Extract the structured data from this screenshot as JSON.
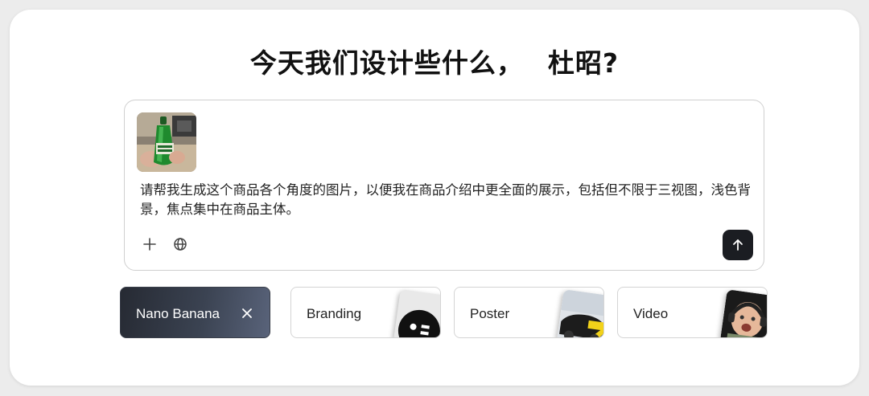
{
  "heading": {
    "text": "今天我们设计些什么，",
    "name": "杜昭?"
  },
  "prompt": {
    "attachment_icon": "product-photo-icon",
    "text": "请帮我生成这个商品各个角度的图片，以便我在商品介绍中更全面的展示，包括但不限于三视图，浅色背景，焦点集中在商品主体。",
    "tools": [
      {
        "icon": "plus-icon"
      },
      {
        "icon": "globe-icon"
      }
    ],
    "send_icon": "arrow-up-icon"
  },
  "chips": [
    {
      "label": "Nano Banana",
      "selected": true,
      "icon": "close-icon"
    },
    {
      "label": "Branding",
      "selected": false,
      "icon": "branding-thumbnail-icon"
    },
    {
      "label": "Poster",
      "selected": false,
      "icon": "car-poster-thumbnail-icon"
    },
    {
      "label": "Video",
      "selected": false,
      "icon": "baby-video-thumbnail-icon"
    }
  ],
  "colors": {
    "accent_dark": "#1b1d22",
    "chip_active_start": "#262a33",
    "chip_active_end": "#59637a"
  }
}
